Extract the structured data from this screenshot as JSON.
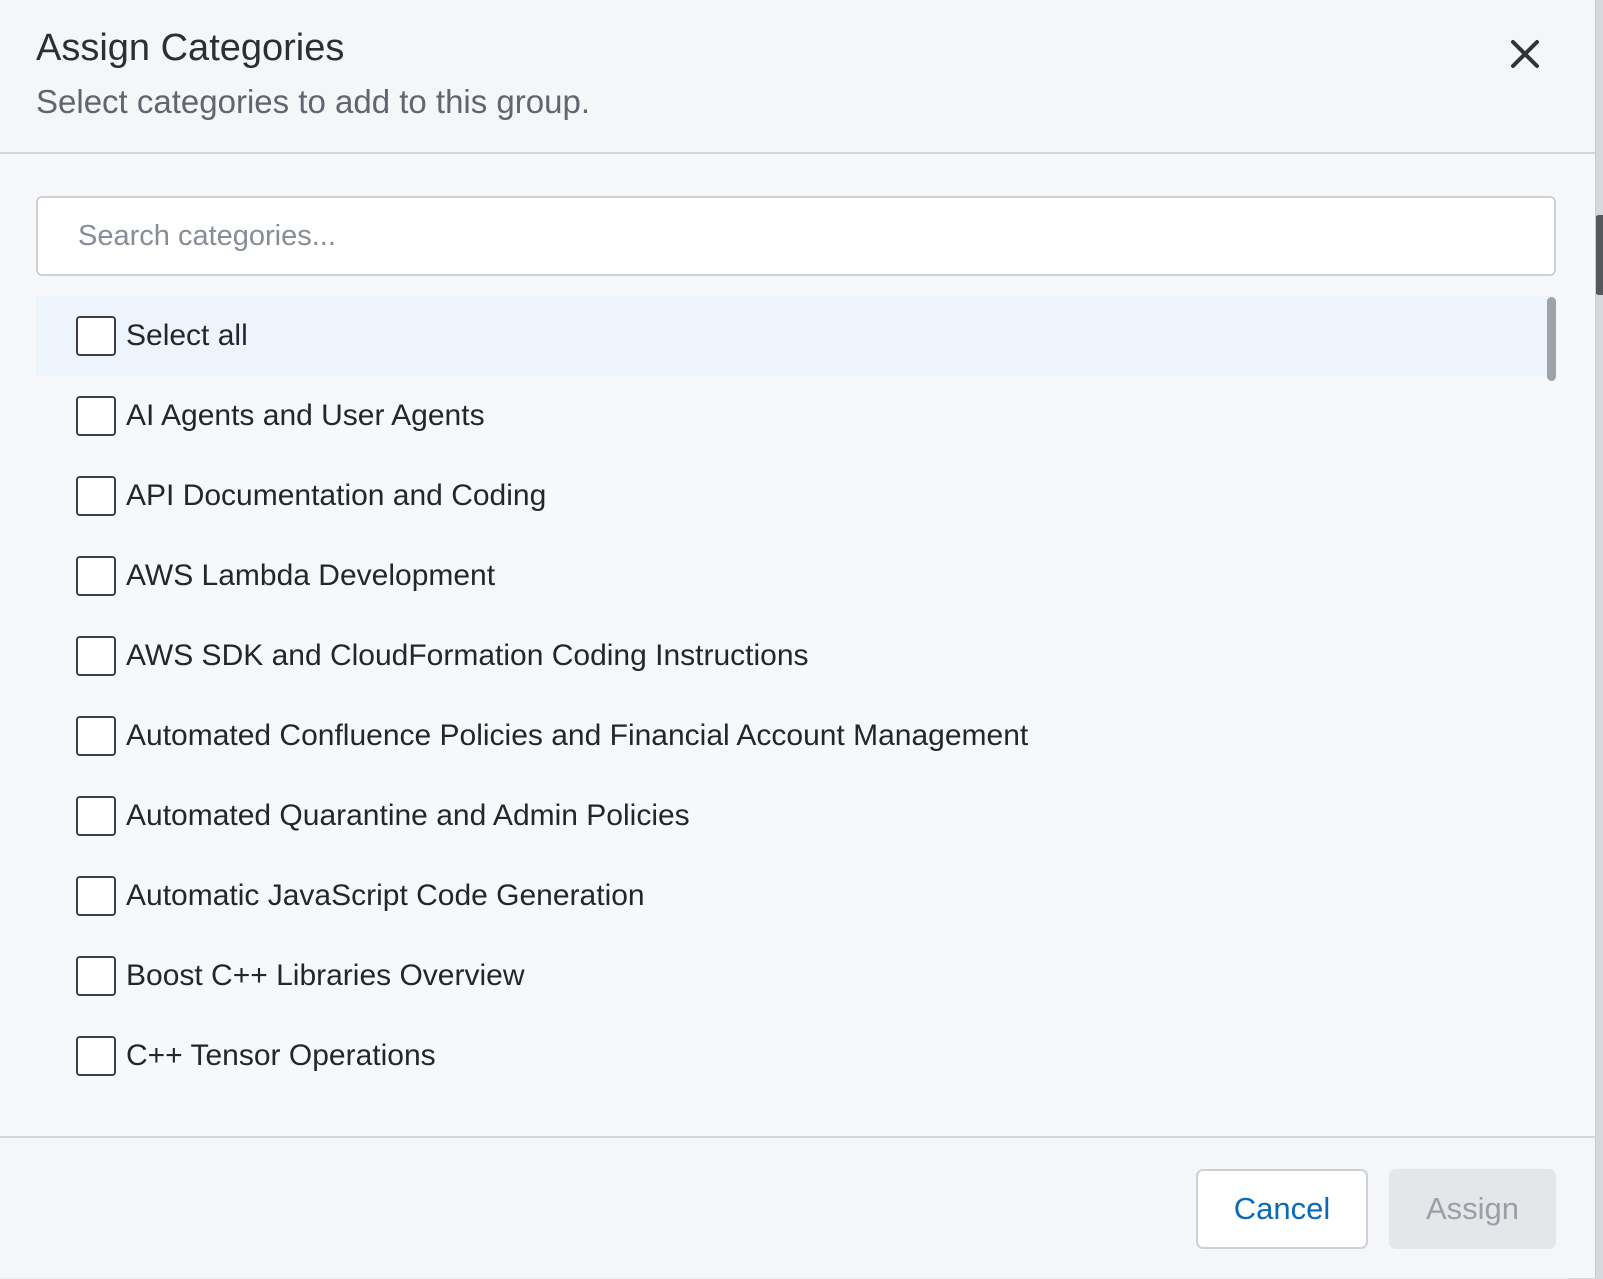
{
  "dialog": {
    "title": "Assign Categories",
    "subtitle": "Select categories to add to this group.",
    "close_icon": "close-icon"
  },
  "search": {
    "placeholder": "Search categories...",
    "value": ""
  },
  "list": {
    "select_all_label": "Select all",
    "items": [
      {
        "label": "AI Agents and User Agents",
        "checked": false
      },
      {
        "label": "API Documentation and Coding",
        "checked": false
      },
      {
        "label": "AWS Lambda Development",
        "checked": false
      },
      {
        "label": "AWS SDK and CloudFormation Coding Instructions",
        "checked": false
      },
      {
        "label": "Automated Confluence Policies and Financial Account Management",
        "checked": false
      },
      {
        "label": "Automated Quarantine and Admin Policies",
        "checked": false
      },
      {
        "label": "Automatic JavaScript Code Generation",
        "checked": false
      },
      {
        "label": "Boost C++ Libraries Overview",
        "checked": false
      },
      {
        "label": "C++ Tensor Operations",
        "checked": false
      }
    ]
  },
  "footer": {
    "cancel_label": "Cancel",
    "assign_label": "Assign",
    "assign_disabled": true
  },
  "colors": {
    "accent": "#0b6ab8",
    "highlight_row": "#eef4fb",
    "disabled_button": "#e4e6e9"
  }
}
